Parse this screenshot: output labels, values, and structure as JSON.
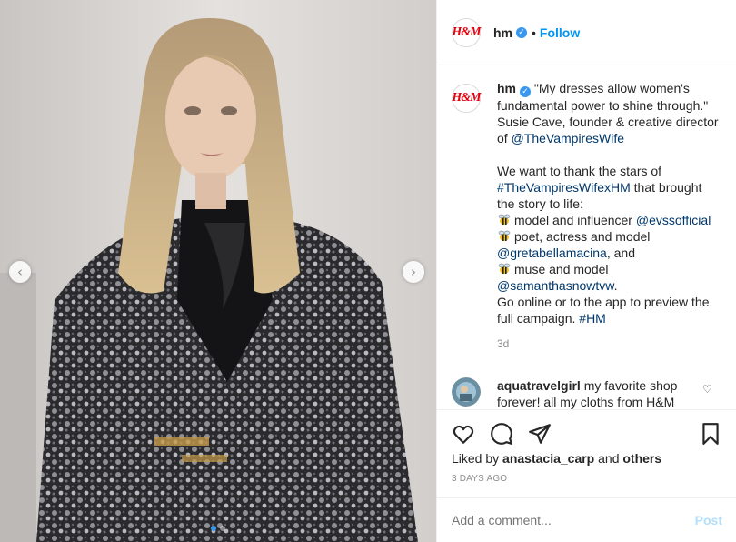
{
  "brand": {
    "logo_text": "H&M",
    "accent_color": "#e50010",
    "link_color": "#0095f6"
  },
  "header": {
    "username": "hm",
    "verified_icon": "verified-badge-icon",
    "separator": "•",
    "follow_label": "Follow"
  },
  "media": {
    "prev_icon": "chevron-left-icon",
    "next_icon": "chevron-right-icon",
    "prev_glyph": "‹",
    "next_glyph": "›",
    "slide_count": 2,
    "active_slide": 1
  },
  "caption": {
    "username": "hm",
    "verified_icon": "verified-badge-icon",
    "quote": "\"My dresses allow women's fundamental power to shine through.\" Susie Cave, founder & creative director of",
    "mention_creator": "@TheVampiresWife",
    "thanks_text": "We want to thank the stars of",
    "hashtag_collab": "#TheVampiresWifexHM",
    "thanks_suffix": "that brought the story to life:",
    "line1_text": "model and influencer",
    "line1_mention": "@evssofficial",
    "line2_text": "poet, actress and model",
    "line2_mention": "@gretabellamacina",
    "line2_suffix": ", and",
    "line3_text": "muse and model",
    "line3_mention": "@samanthasnowtvw",
    "line3_suffix": ".",
    "closing_text": "Go online or to the app to preview the full campaign.",
    "hashtag_brand": "#HM",
    "emoji_icon": "bee-icon",
    "time": "3d"
  },
  "comment": {
    "username": "aquatravelgirl",
    "text": "my favorite shop forever! all my cloths from H&M",
    "like_icon": "heart-outline-icon",
    "like_glyph": "♡"
  },
  "actions": {
    "like_icon": "heart-icon",
    "comment_icon": "comment-icon",
    "share_icon": "paper-plane-icon",
    "save_icon": "bookmark-icon"
  },
  "likes": {
    "prefix": "Liked by",
    "user": "anastacia_carp",
    "joiner": "and",
    "others": "others"
  },
  "date": "3 DAYS AGO",
  "add_comment": {
    "placeholder": "Add a comment...",
    "post_label": "Post"
  }
}
